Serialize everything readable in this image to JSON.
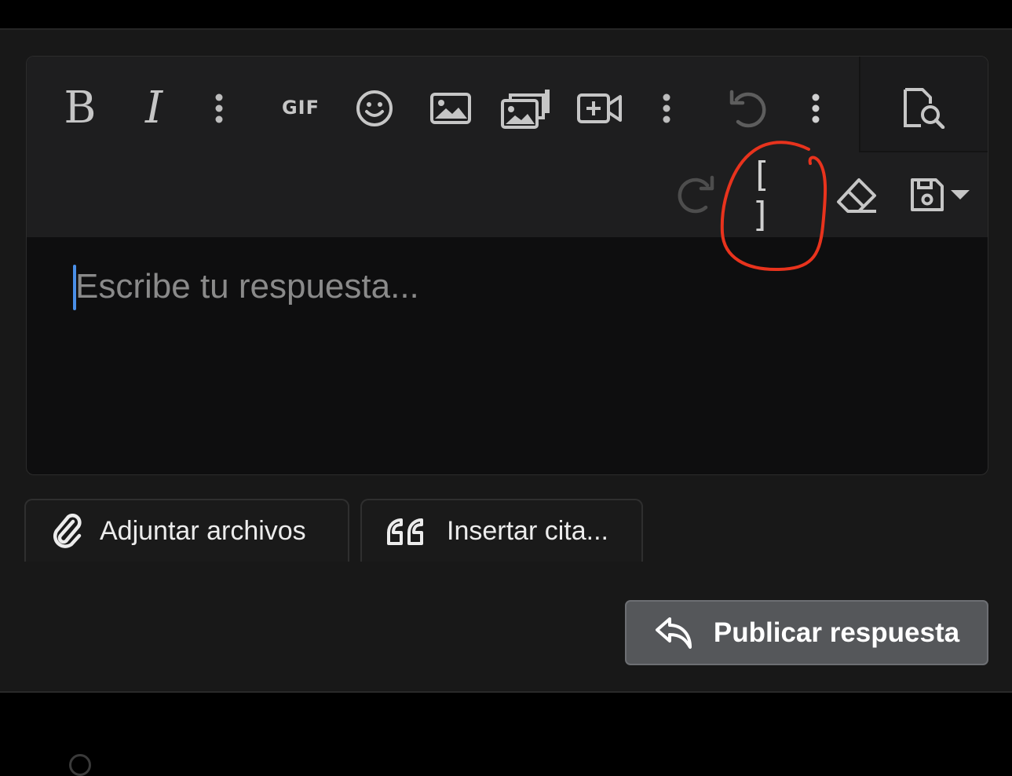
{
  "editor": {
    "placeholder": "Escribe tu respuesta...",
    "toolbar": {
      "bold": "B",
      "italic": "I",
      "gif": "GIF",
      "code_brackets": "[ ]"
    }
  },
  "actions": {
    "attach_label": "Adjuntar archivos",
    "quote_label": "Insertar cita...",
    "publish_label": "Publicar respuesta"
  },
  "icons": {
    "more": "vertical-ellipsis-icon",
    "emoji": "smiley-icon",
    "image": "image-icon",
    "gallery": "media-gallery-icon",
    "video": "video-add-icon",
    "undo": "undo-icon",
    "redo": "redo-icon",
    "eraser": "eraser-icon",
    "save": "floppy-icon",
    "preview": "document-search-icon",
    "attach": "paperclip-icon",
    "quote": "quote-icon",
    "reply": "reply-icon"
  },
  "colors": {
    "background": "#181818",
    "editor_bg": "#0e0e0f",
    "toolbar_bg": "#1e1e1f",
    "caret": "#4a8fe8",
    "annotation": "#e8331d",
    "publish_bg": "#55575a"
  }
}
